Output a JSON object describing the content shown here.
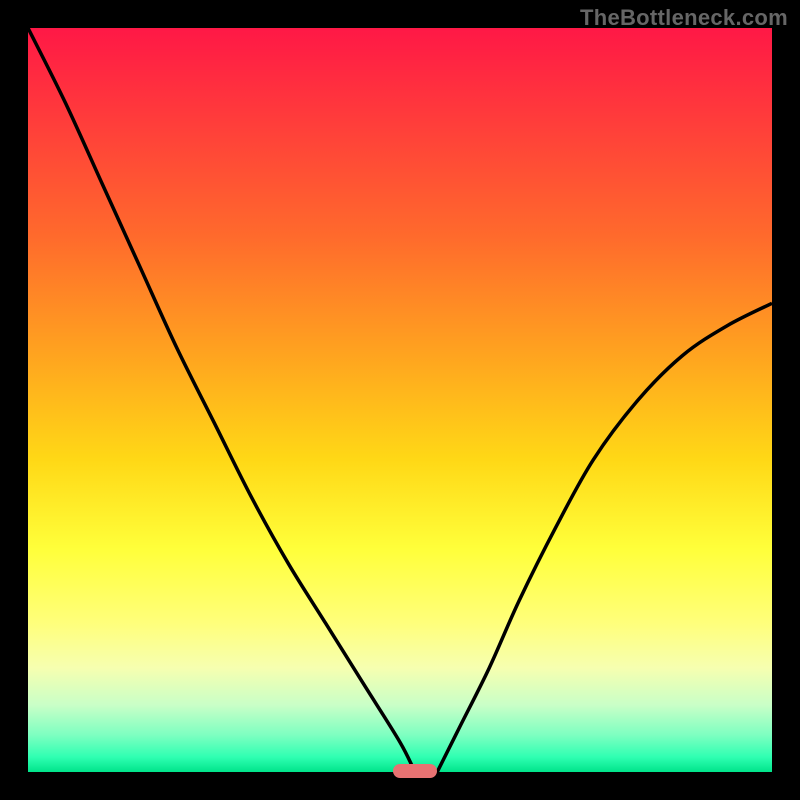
{
  "watermark": "TheBottleneck.com",
  "chart_data": {
    "type": "line",
    "title": "",
    "xlabel": "",
    "ylabel": "",
    "xlim": [
      0,
      100
    ],
    "ylim": [
      0,
      100
    ],
    "series": [
      {
        "name": "left-curve",
        "x": [
          0,
          5,
          10,
          15,
          20,
          25,
          30,
          35,
          40,
          45,
          50,
          52
        ],
        "y": [
          100,
          90,
          79,
          68,
          57,
          47,
          37,
          28,
          20,
          12,
          4,
          0
        ]
      },
      {
        "name": "right-curve",
        "x": [
          55,
          58,
          62,
          66,
          71,
          76,
          82,
          88,
          94,
          100
        ],
        "y": [
          0,
          6,
          14,
          23,
          33,
          42,
          50,
          56,
          60,
          63
        ]
      }
    ],
    "marker": {
      "x_center": 52,
      "y": 0,
      "width_pct": 6
    },
    "background_gradient": {
      "top_color": "#ff1846",
      "mid_color": "#ffff3a",
      "bottom_color": "#00e48a"
    }
  },
  "colors": {
    "frame": "#000000",
    "curve": "#000000",
    "marker": "#e77272",
    "watermark": "#666666"
  }
}
